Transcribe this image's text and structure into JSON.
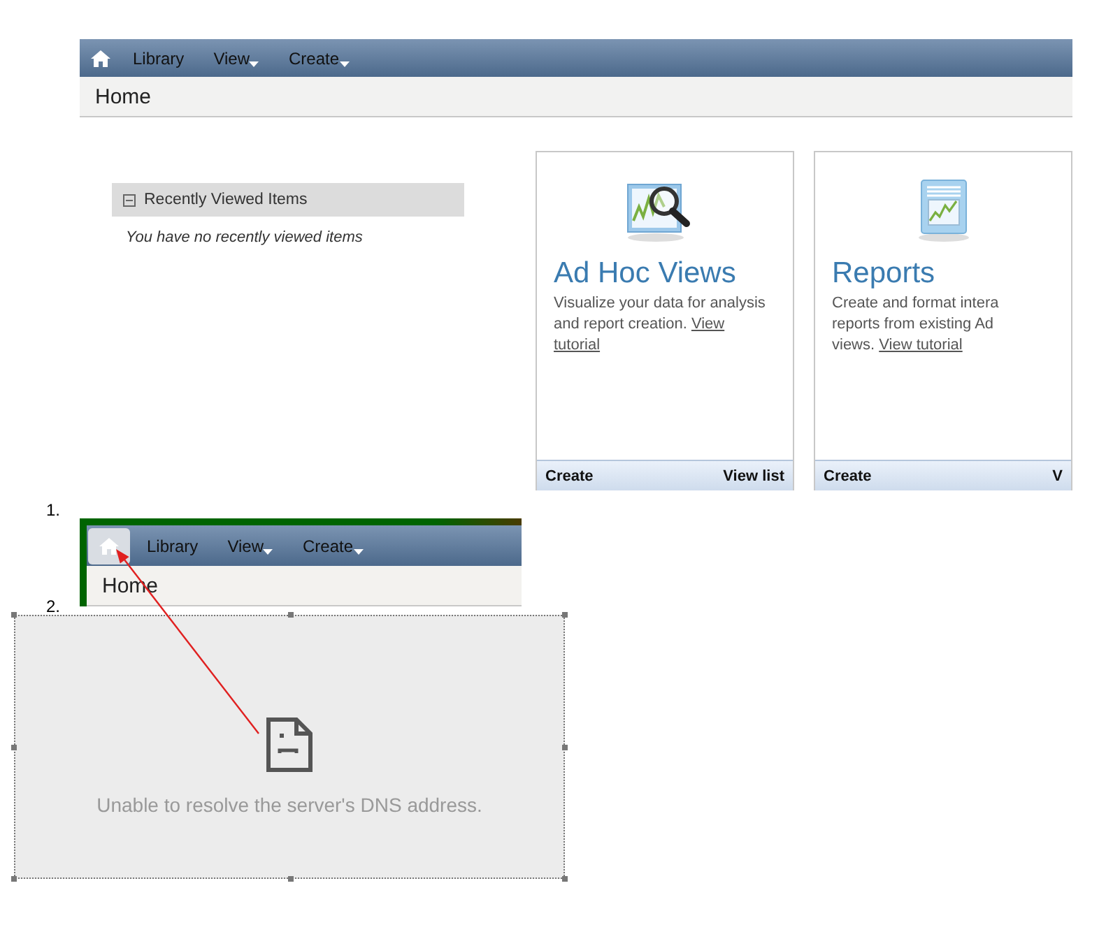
{
  "nav": {
    "home_selected": false,
    "items": [
      {
        "label": "Library",
        "kind": "link"
      },
      {
        "label": "View",
        "kind": "menu"
      },
      {
        "label": "Create",
        "kind": "menu"
      }
    ]
  },
  "breadcrumb": "Home",
  "recent": {
    "title": "Recently Viewed Items",
    "expanded": true,
    "empty_text": "You have no recently viewed items"
  },
  "cards": [
    {
      "kind": "adhoc",
      "title": "Ad Hoc Views",
      "lines": [
        [
          {
            "text": "Visualize your data for analysis",
            "link": false
          }
        ],
        [
          {
            "text": "and report creation. ",
            "link": false
          },
          {
            "text": "View",
            "link": true
          }
        ],
        [
          {
            "text": "tutorial",
            "link": true
          }
        ]
      ],
      "actions": [
        "Create",
        "View list"
      ]
    },
    {
      "kind": "reports",
      "title": "Reports",
      "lines": [
        [
          {
            "text": "Create and format intera",
            "link": false
          }
        ],
        [
          {
            "text": "reports from existing Ad",
            "link": false
          }
        ],
        [
          {
            "text": "views. ",
            "link": false
          },
          {
            "text": "View tutorial",
            "link": true
          }
        ]
      ],
      "actions": [
        "Create",
        "V"
      ]
    }
  ],
  "steps": [
    {
      "number": "1.",
      "kind": "screenshot",
      "nav": {
        "home_selected": true,
        "items": [
          {
            "label": "Library",
            "kind": "link"
          },
          {
            "label": "View",
            "kind": "menu"
          },
          {
            "label": "Create",
            "kind": "menu"
          }
        ]
      },
      "breadcrumb": "Home"
    },
    {
      "number": "2.",
      "kind": "error",
      "message": "Unable to resolve the server's DNS address."
    }
  ]
}
